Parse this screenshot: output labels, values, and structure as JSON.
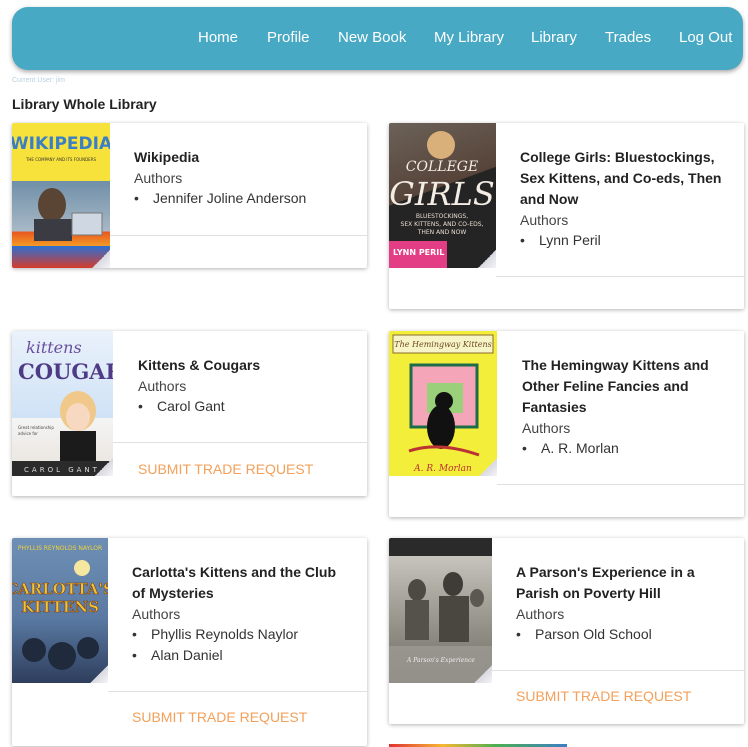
{
  "nav": {
    "items": [
      "Home",
      "Profile",
      "New Book",
      "My Library",
      "Library",
      "Trades",
      "Log Out"
    ]
  },
  "current_user": "Current User: jim",
  "page_title": "Library Whole Library",
  "authors_label": "Authors",
  "trade_label": "SUBMIT TRADE REQUEST",
  "colors": {
    "nav": "#47a9c4",
    "accent": "#f3a05a"
  },
  "books": [
    {
      "title": "Wikipedia",
      "authors": [
        "Jennifer Joline Anderson"
      ],
      "cover": {
        "text": "WIKIPEDIA",
        "subtext": "THE COMPANY AND ITS FOUNDERS"
      }
    },
    {
      "title": "College Girls: Bluestockings, Sex Kittens, and Co-eds, Then and Now",
      "authors": [
        "Lynn Peril"
      ],
      "cover": {
        "text": "COLLEGE GIRLS",
        "subtext": "BLUESTOCKINGS, SEX KITTENS, AND CO-EDS, THEN AND NOW",
        "author": "LYNN PERIL"
      }
    },
    {
      "title": "Kittens & Cougars",
      "authors": [
        "Carol Gant"
      ],
      "cover": {
        "text": "Kittens & COUGARS",
        "author": "CAROL GANT"
      }
    },
    {
      "title": "The Hemingway Kittens and Other Feline Fancies and Fantasies",
      "authors": [
        "A. R. Morlan"
      ],
      "cover": {
        "text": "The Hemingway Kittens",
        "author": "A. R. Morlan"
      }
    },
    {
      "title": "Carlotta's Kittens and the Club of Mysteries",
      "authors": [
        "Phyllis Reynolds Naylor",
        "Alan Daniel"
      ],
      "cover": {
        "text": "CARLOTTA'S KITTENS",
        "author": "PHYLLIS REYNOLDS NAYLOR"
      }
    },
    {
      "title": "A Parson's Experience in a Parish on Poverty Hill",
      "authors": [
        "Parson Old School"
      ],
      "cover": {
        "text": "A Parson's Experience"
      }
    }
  ]
}
